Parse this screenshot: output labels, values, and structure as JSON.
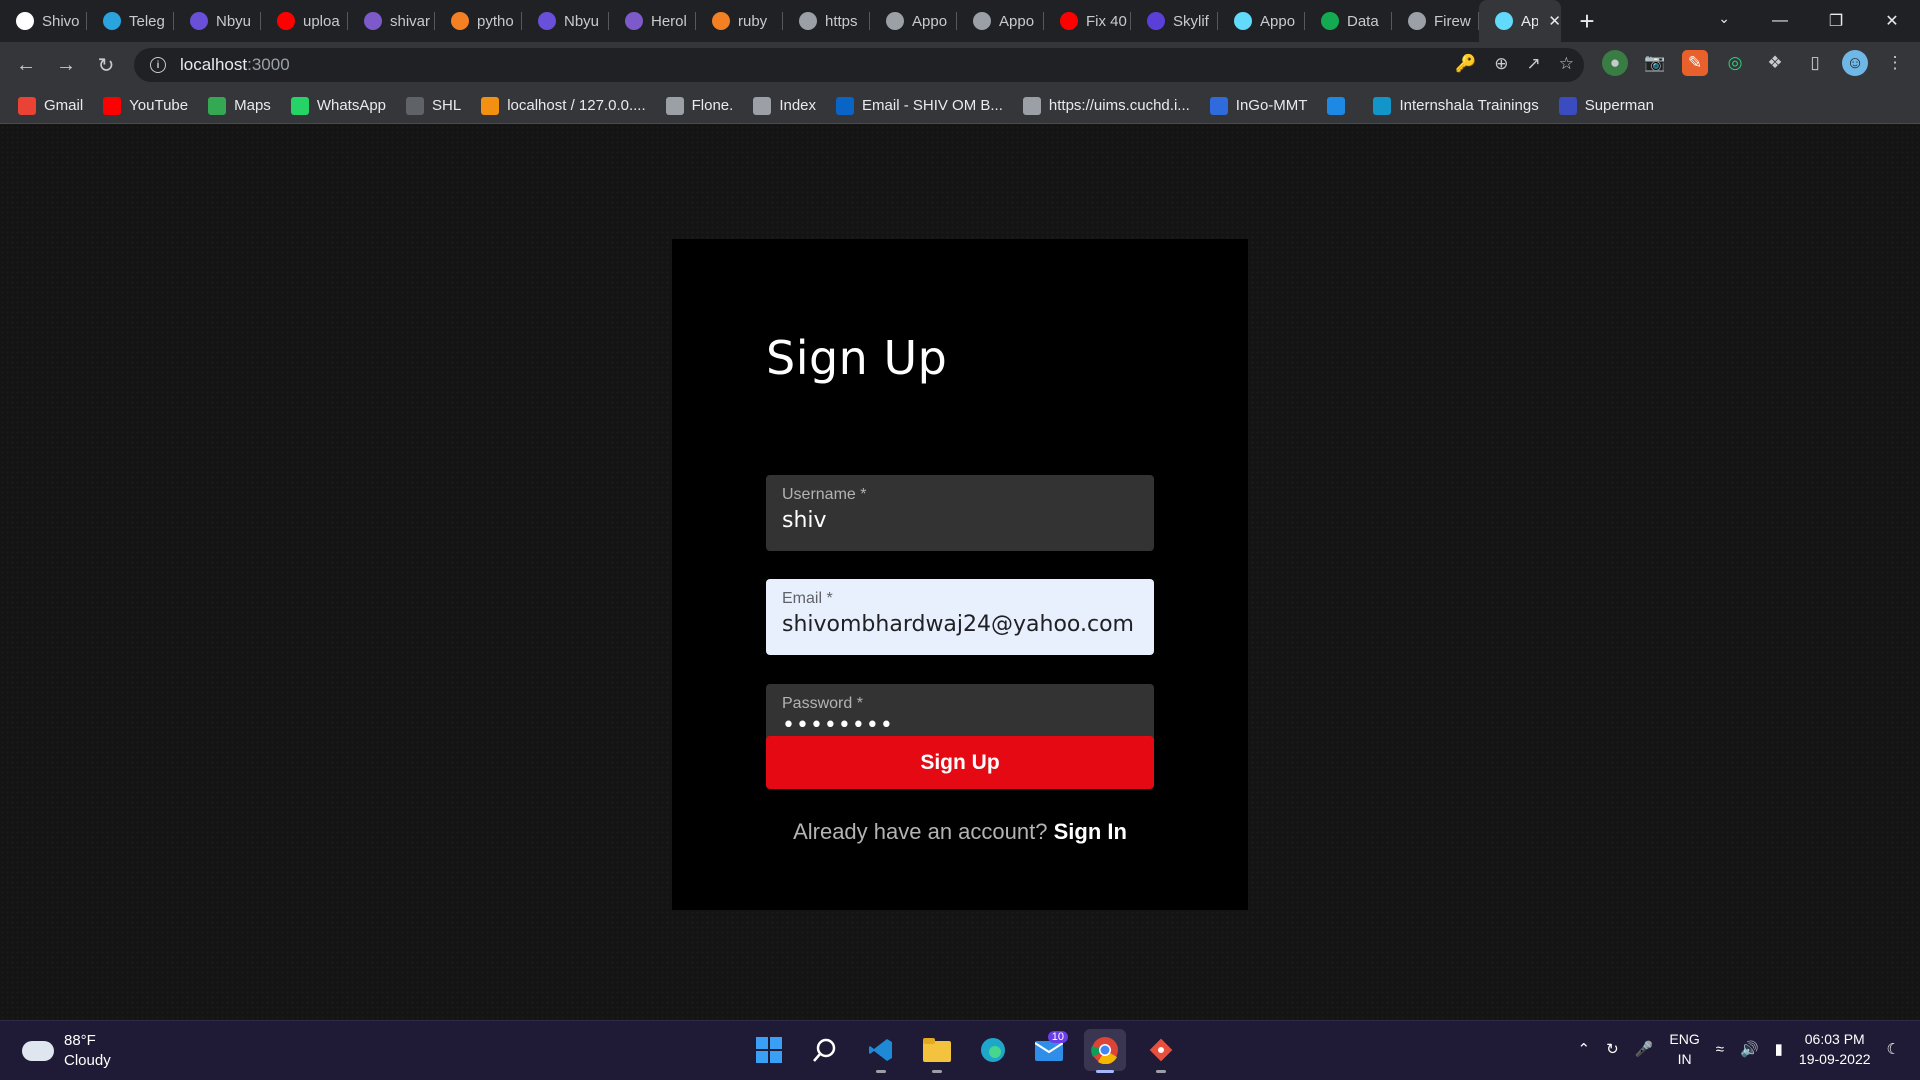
{
  "browser": {
    "tabs": [
      {
        "label": "Shivo",
        "icon": "github-icon",
        "color": "#ffffff"
      },
      {
        "label": "Teleg",
        "icon": "telegram-icon",
        "color": "#2aa3df"
      },
      {
        "label": "Nbyu",
        "icon": "list-icon",
        "color": "#6a4fd8"
      },
      {
        "label": "uploa",
        "icon": "youtube-icon",
        "color": "#ff0000"
      },
      {
        "label": "shivar",
        "icon": "heroku-icon",
        "color": "#7c5ac9"
      },
      {
        "label": "pytho",
        "icon": "stackoverflow-icon",
        "color": "#f48024"
      },
      {
        "label": "Nbyu",
        "icon": "list-icon",
        "color": "#6a4fd8"
      },
      {
        "label": "Herol",
        "icon": "heroku-icon",
        "color": "#7c5ac9"
      },
      {
        "label": "ruby",
        "icon": "stackoverflow-icon",
        "color": "#f48024"
      },
      {
        "label": "https",
        "icon": "globe-icon",
        "color": "#9aa0a6"
      },
      {
        "label": "Appo",
        "icon": "globe-icon",
        "color": "#9aa0a6"
      },
      {
        "label": "Appo",
        "icon": "globe-icon",
        "color": "#9aa0a6"
      },
      {
        "label": "Fix 40",
        "icon": "youtube-icon",
        "color": "#ff0000"
      },
      {
        "label": "Skylif",
        "icon": "skylift-icon",
        "color": "#5a3fd8"
      },
      {
        "label": "Appo",
        "icon": "react-icon",
        "color": "#61dafb"
      },
      {
        "label": "Data",
        "icon": "mongodb-icon",
        "color": "#13aa52"
      },
      {
        "label": "Firew",
        "icon": "globe-icon",
        "color": "#9aa0a6"
      },
      {
        "label": "Ap",
        "icon": "react-icon",
        "color": "#61dafb",
        "active": true
      }
    ],
    "url_host": "localhost",
    "url_port": ":3000",
    "bookmarks": [
      {
        "label": "Gmail",
        "icon": "gmail-icon",
        "color": "#ea4335"
      },
      {
        "label": "YouTube",
        "icon": "youtube-icon",
        "color": "#ff0000"
      },
      {
        "label": "Maps",
        "icon": "maps-icon",
        "color": "#34a853"
      },
      {
        "label": "WhatsApp",
        "icon": "whatsapp-icon",
        "color": "#25d366"
      },
      {
        "label": "SHL",
        "icon": "shl-icon",
        "color": "#5f6368"
      },
      {
        "label": "localhost / 127.0.0....",
        "icon": "phpmyadmin-icon",
        "color": "#f29111"
      },
      {
        "label": "Flone.",
        "icon": "globe-icon",
        "color": "#9aa0a6"
      },
      {
        "label": "Index",
        "icon": "globe-icon",
        "color": "#9aa0a6"
      },
      {
        "label": "Email - SHIV OM B...",
        "icon": "outlook-icon",
        "color": "#0a64c6"
      },
      {
        "label": "https://uims.cuchd.i...",
        "icon": "globe-icon",
        "color": "#9aa0a6"
      },
      {
        "label": "InGo-MMT",
        "icon": "ingo-icon",
        "color": "#2f6bdc"
      },
      {
        "label": "",
        "icon": "fl-icon",
        "color": "#1e88e5"
      },
      {
        "label": "Internshala Trainings",
        "icon": "internshala-icon",
        "color": "#1295c9"
      },
      {
        "label": "Superman",
        "icon": "superman-icon",
        "color": "#3b4cc0"
      }
    ]
  },
  "signup": {
    "title": "Sign Up",
    "username_label": "Username *",
    "username_value": "shiv",
    "email_label": "Email *",
    "email_value": "shivombhardwaj24@yahoo.com",
    "password_label": "Password *",
    "password_masked": "••••••••",
    "submit_label": "Sign Up",
    "footer_text": "Already have an account? ",
    "footer_link": "Sign In",
    "accent_color": "#e50914"
  },
  "taskbar": {
    "weather_temp": "88°F",
    "weather_desc": "Cloudy",
    "mail_badge": "10",
    "lang_line1": "ENG",
    "lang_line2": "IN",
    "time": "06:03 PM",
    "date": "19-09-2022"
  }
}
